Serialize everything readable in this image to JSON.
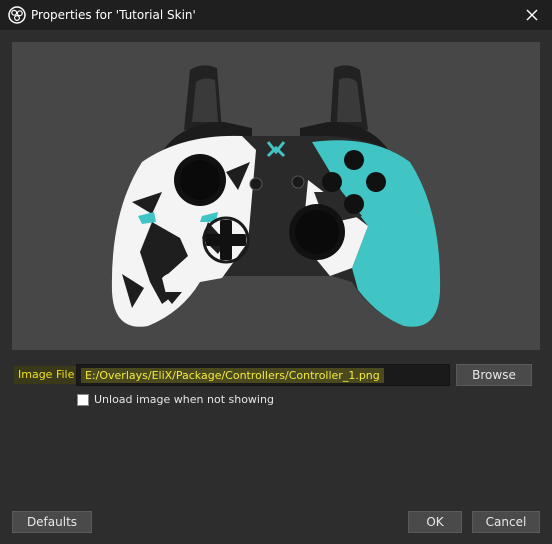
{
  "window": {
    "title": "Properties for 'Tutorial Skin'",
    "app_icon": "obs-icon",
    "close_icon": "close-icon"
  },
  "preview": {
    "image_alt": "controller-skin-image",
    "controller_center_icon": "x-logo-icon"
  },
  "image_file": {
    "label": "Image File",
    "path": "E:/Overlays/EliX/Package/Controllers/Controller_1.png",
    "browse_label": "Browse"
  },
  "unload_option": {
    "label": "Unload image when not showing",
    "checked": false
  },
  "footer": {
    "defaults_label": "Defaults",
    "ok_label": "OK",
    "cancel_label": "Cancel"
  },
  "colors": {
    "accent_teal": "#41c4c4",
    "highlight_yellow": "#f5ea40"
  }
}
